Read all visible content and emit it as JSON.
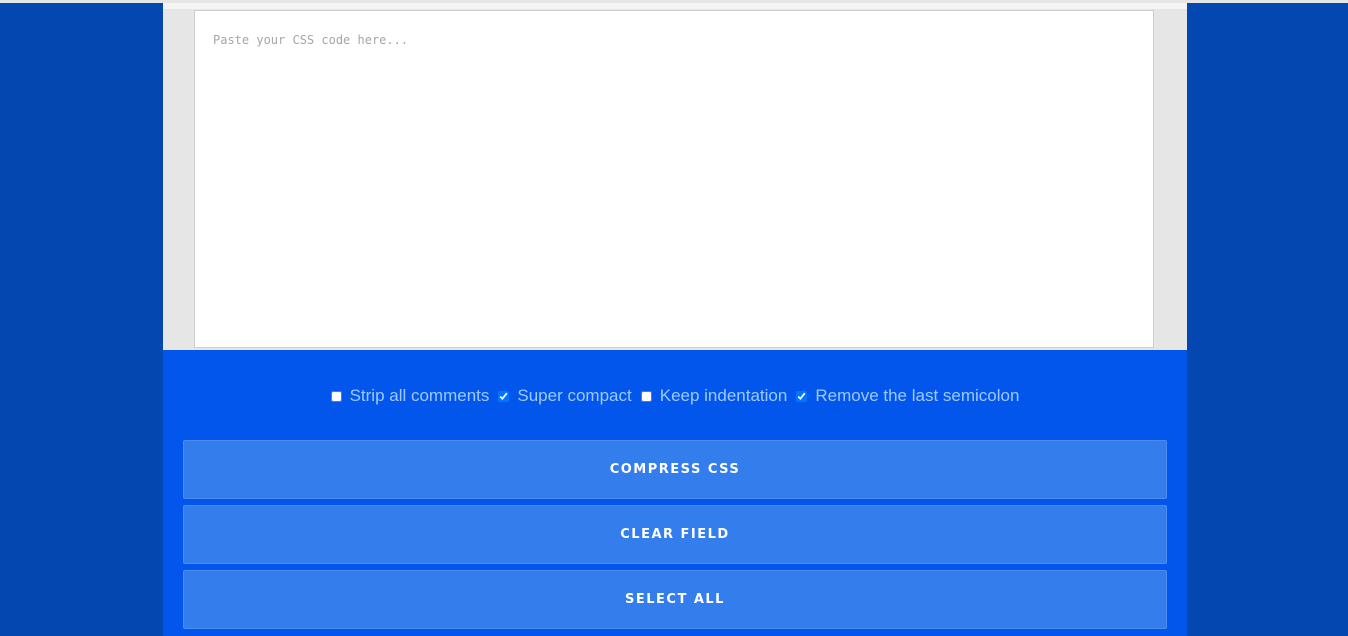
{
  "editor": {
    "placeholder": "Paste your CSS code here..."
  },
  "options": [
    {
      "label": "Strip all comments",
      "checked": false
    },
    {
      "label": "Super compact",
      "checked": true
    },
    {
      "label": "Keep indentation",
      "checked": false
    },
    {
      "label": "Remove the last semicolon",
      "checked": true
    }
  ],
  "buttons": {
    "compress": "COMPRESS CSS",
    "clear": "CLEAR FIELD",
    "select_all": "SELECT ALL"
  },
  "colors": {
    "page_background": "#0447b0",
    "panel_background": "#0356eb",
    "button_background": "#347ded",
    "option_text": "#9cc9ff"
  }
}
